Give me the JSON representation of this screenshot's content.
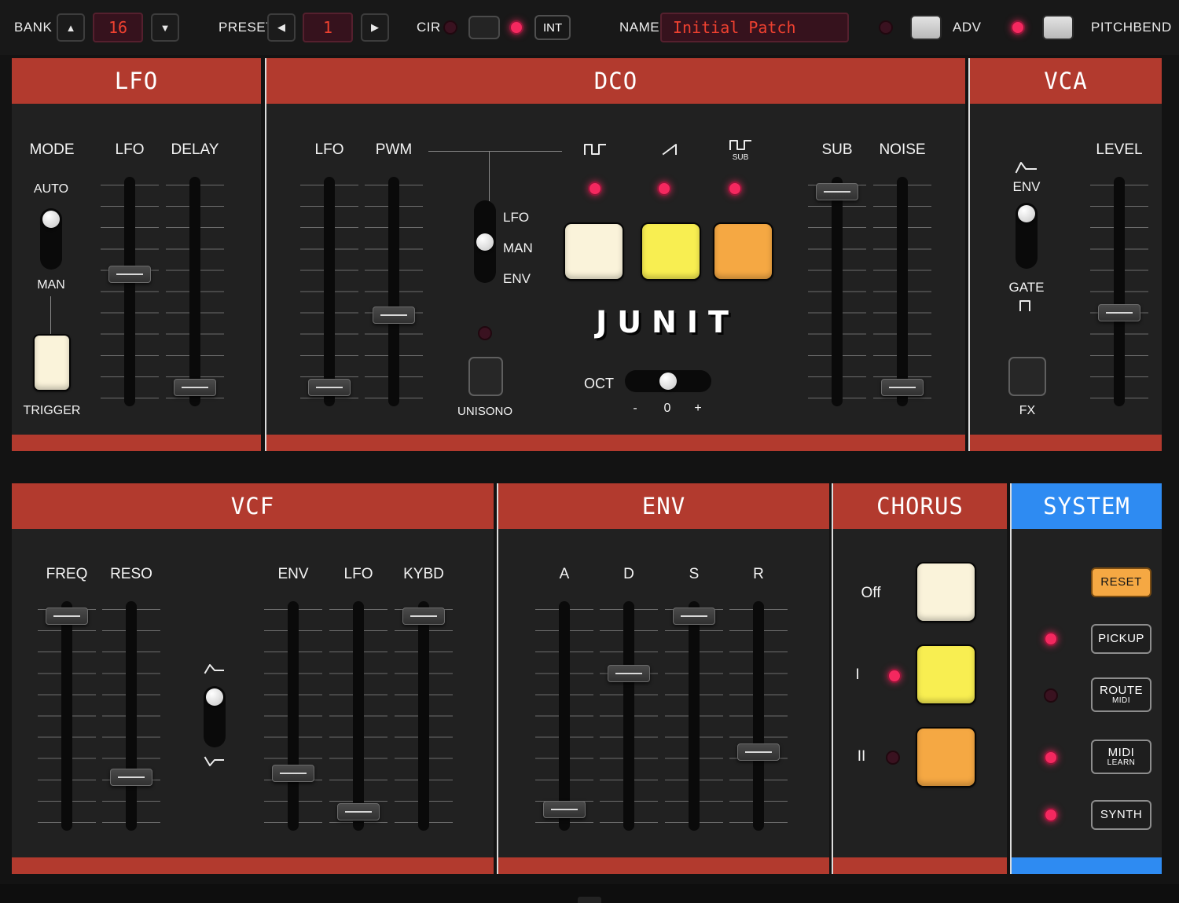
{
  "colors": {
    "header-red": "#b23a2e",
    "header-blue": "#2e8bf2",
    "led-pink": "#f4285f",
    "pad-cream": "#faf3da",
    "pad-yellow": "#f8ee51",
    "pad-orange": "#f5a843",
    "display-red": "#ef4130"
  },
  "topbar": {
    "bank_label": "BANK",
    "bank_value": "16",
    "preset_label": "PRESET",
    "preset_value": "1",
    "cir_label": "CIR",
    "int_label": "INT",
    "name_label": "NAME",
    "name_value": "Initial Patch",
    "adv_label": "ADV",
    "pitchbend_label": "PITCHBEND"
  },
  "leds": {
    "cir": false,
    "int": true,
    "adv": false,
    "pitchbend": true,
    "wave_pulse": true,
    "wave_saw": true,
    "wave_sub": true,
    "unisono": false,
    "chorus_i": true,
    "chorus_ii": false,
    "pickup": true,
    "route": false,
    "midi": true,
    "synth": true
  },
  "lfo": {
    "title": "LFO",
    "mode_label": "MODE",
    "rate_label": "LFO",
    "delay_label": "DELAY",
    "auto_label": "AUTO",
    "man_label": "MAN",
    "trigger_label": "TRIGGER",
    "mode": "top",
    "rate": 58,
    "delay": 5
  },
  "dco": {
    "title": "DCO",
    "lfo_label": "LFO",
    "pwm_label": "PWM",
    "switch_option_1": "LFO",
    "switch_option_2": "MAN",
    "switch_option_3": "ENV",
    "pwm_source": "middle",
    "sub_icon_caption": "SUB",
    "logo": "JUNIT",
    "unisono_label": "UNISONO",
    "oct_label": "OCT",
    "oct_minus": "-",
    "oct_zero": "0",
    "oct_plus": "+",
    "oct_value": 50,
    "sub_label": "SUB",
    "noise_label": "NOISE",
    "lfo_amount": 5,
    "pwm_amount": 39,
    "sub_level": 97,
    "noise_level": 5
  },
  "vca": {
    "title": "VCA",
    "env_label": "ENV",
    "gate_label": "GATE",
    "level_label": "LEVEL",
    "fx_label": "FX",
    "mode": "top",
    "level": 40
  },
  "vcf": {
    "title": "VCF",
    "freq_label": "FREQ",
    "reso_label": "RESO",
    "env_label": "ENV",
    "lfo_label": "LFO",
    "kybd_label": "KYBD",
    "polarity": "top",
    "freq": 97,
    "reso": 21,
    "env": 23,
    "lfo": 5,
    "kybd": 97
  },
  "env": {
    "title": "ENV",
    "a_label": "A",
    "d_label": "D",
    "s_label": "S",
    "r_label": "R",
    "attack": 6,
    "decay": 70,
    "sustain": 97,
    "release": 33
  },
  "chorus": {
    "title": "CHORUS",
    "off_label": "Off",
    "mode1_label": "I",
    "mode2_label": "II"
  },
  "system": {
    "title": "SYSTEM",
    "reset_label": "RESET",
    "pickup_label": "PICKUP",
    "route_label": "ROUTE",
    "route_sublabel": "MIDI",
    "midi_label": "MIDI",
    "midi_sublabel": "LEARN",
    "synth_label": "SYNTH"
  }
}
